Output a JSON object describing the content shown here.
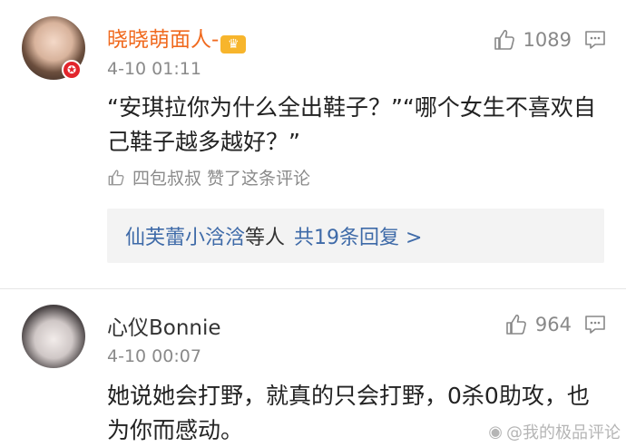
{
  "comments": [
    {
      "username": "晓晓萌面人-",
      "time": "4-10 01:11",
      "like_count": "1089",
      "content": "“安琪拉你为什么全出鞋子？”“哪个女生不喜欢自己鞋子越多越好？”",
      "liked_by": "四包叔叔 赞了这条评论",
      "replies": {
        "names": "仙芙蕾小浛浛",
        "mid": "等人",
        "count_text": "共19条回复 >"
      }
    },
    {
      "username": "心仪Bonnie",
      "time": "4-10 00:07",
      "like_count": "964",
      "content": "她说她会打野，就真的只会打野，0杀0助攻，也为你而感动。"
    }
  ],
  "watermark": "@我的极品评论",
  "colors": {
    "username_highlight": "#f06a1f",
    "link_blue": "#3e6aa8",
    "meta_gray": "#8a8a8a"
  }
}
